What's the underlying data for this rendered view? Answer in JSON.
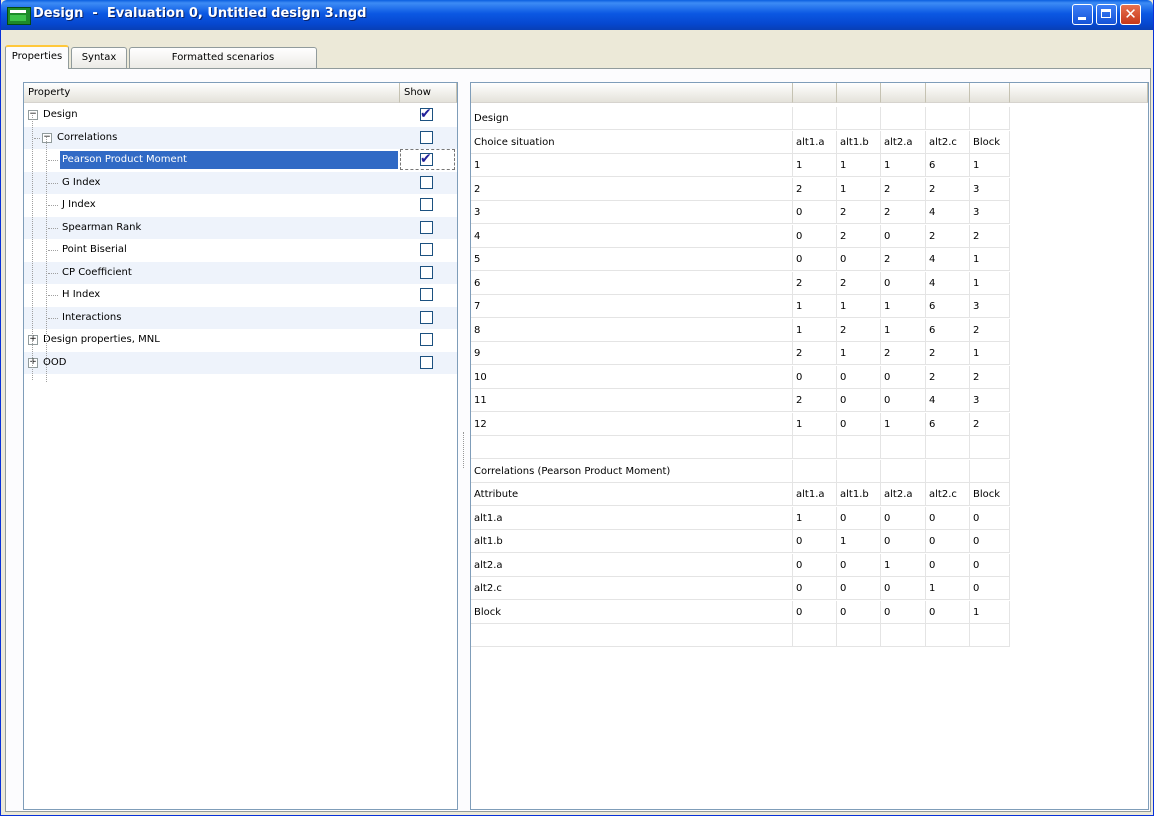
{
  "window": {
    "title": "Design  -  Evaluation 0, Untitled design 3.ngd"
  },
  "tabs": [
    "Properties",
    "Syntax",
    "Formatted scenarios"
  ],
  "tree": {
    "headers": {
      "property": "Property",
      "show": "Show"
    },
    "items": [
      {
        "label": "Design",
        "checked": true,
        "expander": "minus"
      },
      {
        "label": "Correlations",
        "checked": false,
        "expander": "minus"
      },
      {
        "label": "Pearson Product Moment",
        "checked": true,
        "selected": true
      },
      {
        "label": "G Index",
        "checked": false
      },
      {
        "label": "J Index",
        "checked": false
      },
      {
        "label": "Spearman Rank",
        "checked": false
      },
      {
        "label": "Point Biserial",
        "checked": false
      },
      {
        "label": "CP Coefficient",
        "checked": false
      },
      {
        "label": "H Index",
        "checked": false
      },
      {
        "label": "Interactions",
        "checked": false
      },
      {
        "label": "Design properties, MNL",
        "checked": false,
        "expander": "plus"
      },
      {
        "label": "OOD",
        "checked": false,
        "expander": "plus"
      }
    ]
  },
  "grid": {
    "rows": [
      [
        "Design",
        "",
        "",
        "",
        "",
        ""
      ],
      [
        "Choice situation",
        "alt1.a",
        "alt1.b",
        "alt2.a",
        "alt2.c",
        "Block"
      ],
      [
        "1",
        "1",
        "1",
        "1",
        "6",
        "1"
      ],
      [
        "2",
        "2",
        "1",
        "2",
        "2",
        "3"
      ],
      [
        "3",
        "0",
        "2",
        "2",
        "4",
        "3"
      ],
      [
        "4",
        "0",
        "2",
        "0",
        "2",
        "2"
      ],
      [
        "5",
        "0",
        "0",
        "2",
        "4",
        "1"
      ],
      [
        "6",
        "2",
        "2",
        "0",
        "4",
        "1"
      ],
      [
        "7",
        "1",
        "1",
        "1",
        "6",
        "3"
      ],
      [
        "8",
        "1",
        "2",
        "1",
        "6",
        "2"
      ],
      [
        "9",
        "2",
        "1",
        "2",
        "2",
        "1"
      ],
      [
        "10",
        "0",
        "0",
        "0",
        "2",
        "2"
      ],
      [
        "11",
        "2",
        "0",
        "0",
        "4",
        "3"
      ],
      [
        "12",
        "1",
        "0",
        "1",
        "6",
        "2"
      ],
      [
        "",
        "",
        "",
        "",
        "",
        ""
      ],
      [
        "Correlations (Pearson Product Moment)",
        "",
        "",
        "",
        "",
        ""
      ],
      [
        "Attribute",
        "alt1.a",
        "alt1.b",
        "alt2.a",
        "alt2.c",
        "Block"
      ],
      [
        "alt1.a",
        "1",
        "0",
        "0",
        "0",
        "0"
      ],
      [
        "alt1.b",
        "0",
        "1",
        "0",
        "0",
        "0"
      ],
      [
        "alt2.a",
        "0",
        "0",
        "1",
        "0",
        "0"
      ],
      [
        "alt2.c",
        "0",
        "0",
        "0",
        "1",
        "0"
      ],
      [
        "Block",
        "0",
        "0",
        "0",
        "0",
        "1"
      ],
      [
        "",
        "",
        "",
        "",
        "",
        ""
      ]
    ]
  }
}
